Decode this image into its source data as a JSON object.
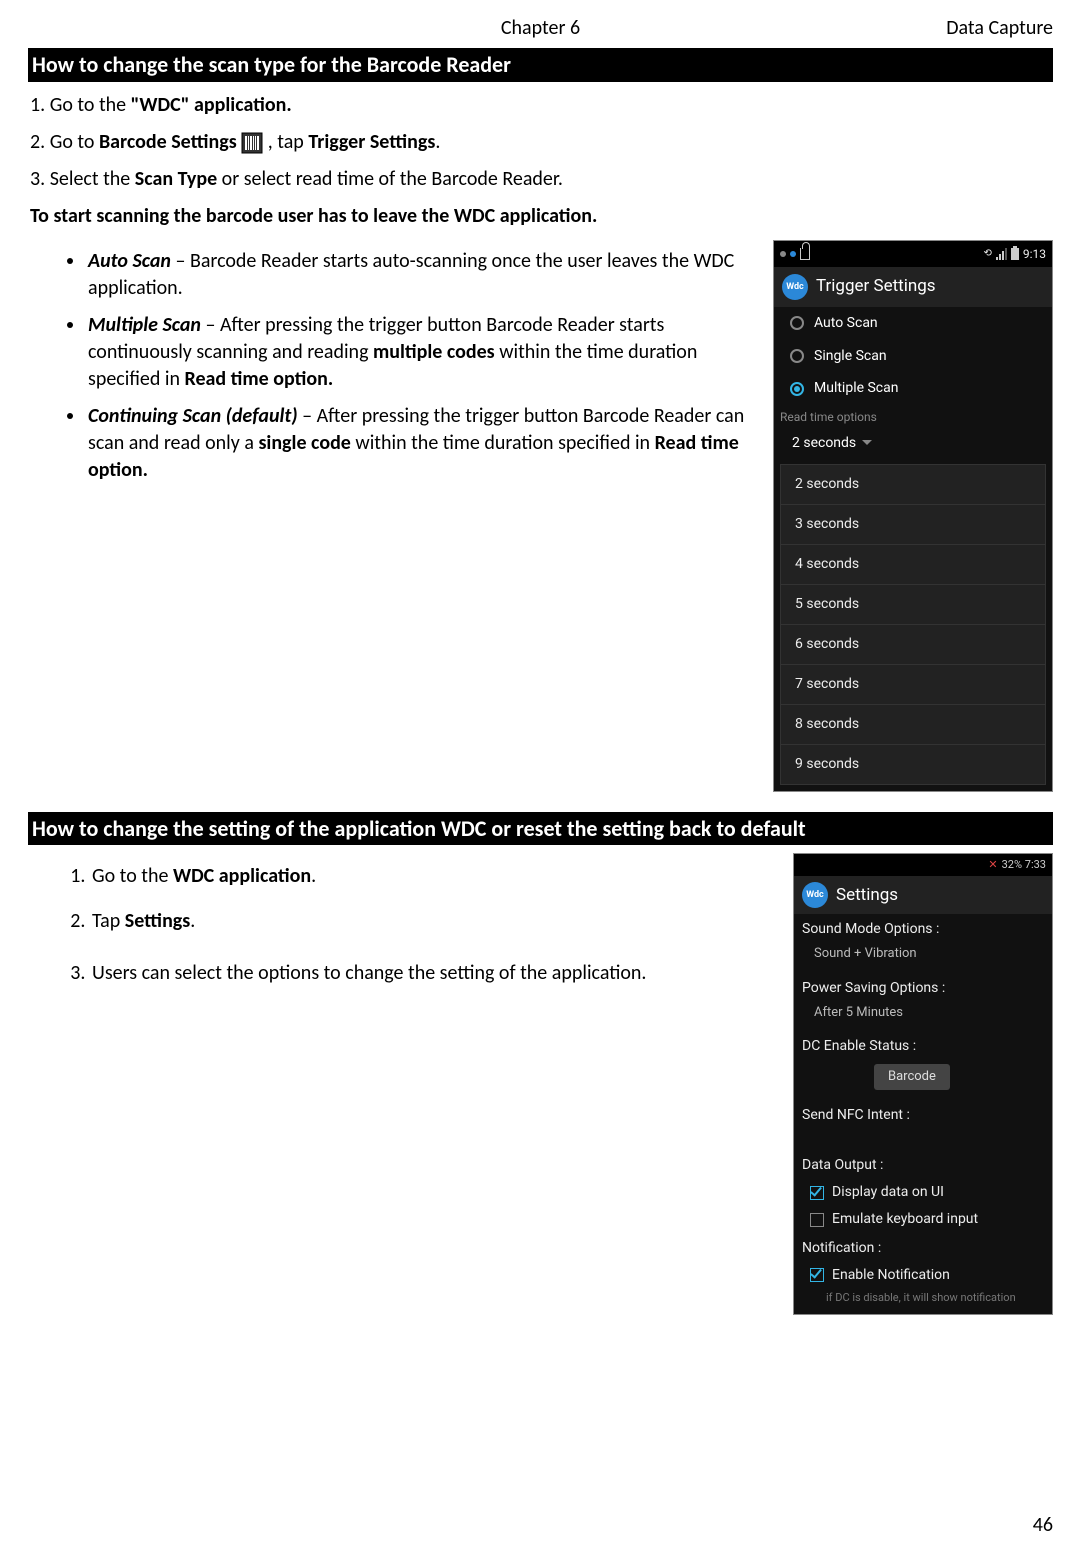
{
  "header": {
    "chapter": "Chapter 6",
    "section": "Data Capture"
  },
  "heading1": "How to change the scan type for the Barcode Reader",
  "step1": {
    "prefix": "1. Go to the ",
    "bold": "\"WDC\" application."
  },
  "step2": {
    "prefix": "2. Go to ",
    "b1": "Barcode Settings ",
    "mid": ", tap ",
    "b2": "Trigger Settings",
    "tail": "."
  },
  "step3": {
    "prefix": "3. Select the ",
    "b1": "Scan Type",
    "tail": " or select read time of the Barcode Reader."
  },
  "leaveNote": "To start scanning the barcode user has to leave the WDC application.",
  "bullets": {
    "auto": {
      "name": "Auto Scan",
      "text": " – Barcode Reader starts auto-scanning once the user leaves the WDC application."
    },
    "multi": {
      "name": "Multiple Scan",
      "lead": " – After pressing the trigger button Barcode Reader starts continuously scanning and reading ",
      "b1": "multiple codes",
      "mid": " within the time duration specified in ",
      "b2": "Read time option."
    },
    "cont": {
      "name": "Continuing Scan (default)",
      "lead": " – After pressing the trigger button Barcode Reader can scan and read only a ",
      "b1": "single code",
      "mid": " within the time duration specified in ",
      "b2": "Read time option."
    }
  },
  "phone1": {
    "time": "9:13",
    "title": "Trigger Settings",
    "radios": {
      "auto": "Auto Scan",
      "single": "Single Scan",
      "multiple": "Multiple Scan"
    },
    "sectionLabel": "Read time options",
    "selectedValue": "2 seconds",
    "options": [
      "2 seconds",
      "3 seconds",
      "4 seconds",
      "5 seconds",
      "6 seconds",
      "7 seconds",
      "8 seconds",
      "9 seconds"
    ]
  },
  "heading2": "How to change the setting of the application WDC or reset the setting back to default",
  "steps2": {
    "s1": {
      "pre": "Go to the ",
      "b": "WDC application",
      "post": "."
    },
    "s2": {
      "pre": "Tap ",
      "b": "Settings",
      "post": "."
    },
    "s3": "Users can select the options to change the setting of the application."
  },
  "phone2": {
    "status": "32% 7:33",
    "title": "Settings",
    "groups": {
      "sound": {
        "label": "Sound Mode Options :",
        "value": "Sound + Vibration"
      },
      "power": {
        "label": "Power Saving Options :",
        "value": "After 5 Minutes"
      },
      "dcen": {
        "label": "DC Enable Status :",
        "btn": "Barcode"
      },
      "nfc": {
        "label": "Send NFC Intent :"
      },
      "dataout": {
        "label": "Data Output :",
        "opt1": "Display data on UI",
        "opt2": "Emulate keyboard input"
      },
      "notif": {
        "label": "Notification :",
        "opt": "Enable Notification",
        "note": "if DC is disable, it will show notification"
      }
    }
  },
  "pageNumber": "46"
}
